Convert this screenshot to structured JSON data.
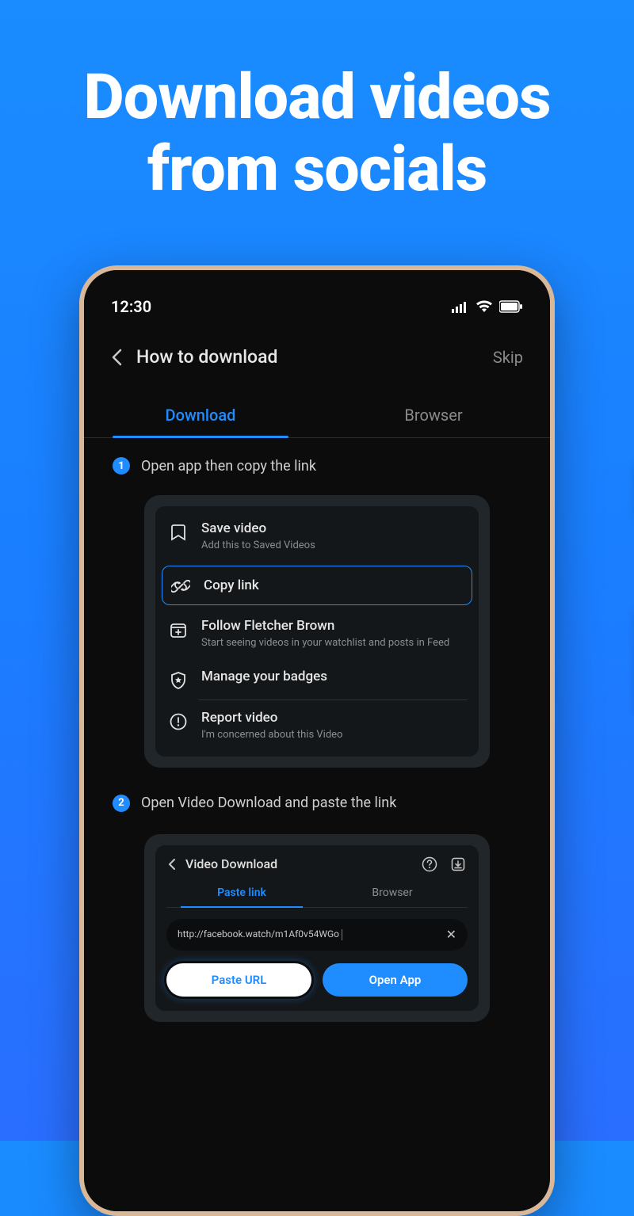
{
  "hero": {
    "line1": "Download videos",
    "line2": "from socials"
  },
  "status": {
    "time": "12:30"
  },
  "header": {
    "title": "How to download",
    "skip": "Skip"
  },
  "tabs": {
    "download": "Download",
    "browser": "Browser"
  },
  "step1": {
    "num": "1",
    "text": "Open app then copy the link"
  },
  "menu": {
    "save": {
      "title": "Save video",
      "sub": "Add this to Saved Videos"
    },
    "copy": {
      "title": "Copy link"
    },
    "follow": {
      "title": "Follow Fletcher Brown",
      "sub": "Start seeing videos in your watchlist and posts in Feed"
    },
    "badges": {
      "title": "Manage your badges"
    },
    "report": {
      "title": "Report video",
      "sub": "I'm concerned about this Video"
    }
  },
  "step2": {
    "num": "2",
    "text": "Open Video Download and paste the link"
  },
  "app": {
    "title": "Video Download",
    "tab_paste": "Paste link",
    "tab_browser": "Browser",
    "url": "http://facebook.watch/m1Af0v54WGo",
    "btn_paste": "Paste URL",
    "btn_open": "Open App"
  }
}
